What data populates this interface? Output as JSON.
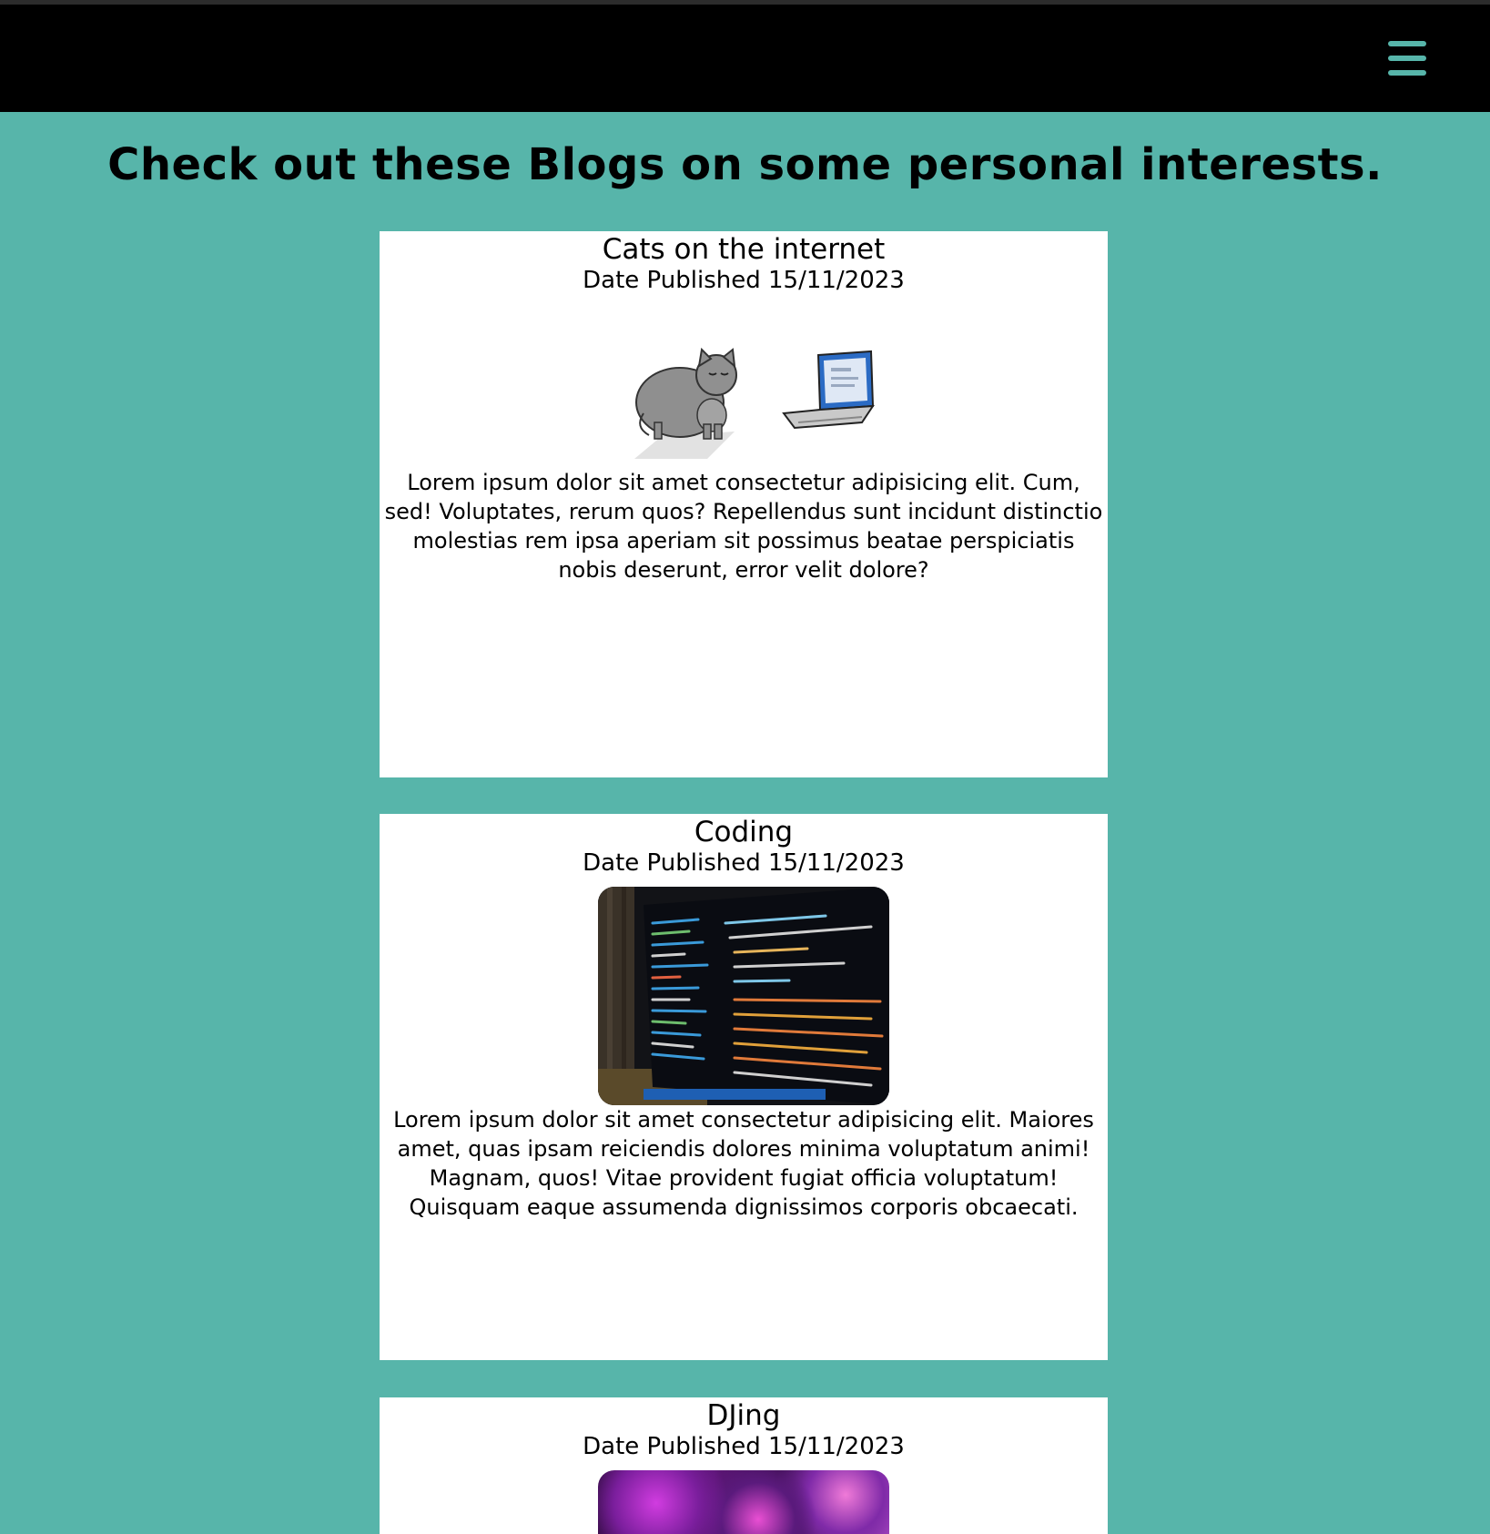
{
  "nav": {
    "menu_icon": "hamburger-menu-icon",
    "accent_color": "#57b5aa",
    "background_color": "#000000"
  },
  "page": {
    "title": "Check out these Blogs on some personal interests.",
    "background_color": "#57b5aa"
  },
  "blogs": [
    {
      "title": "Cats on the internet",
      "date": "Date Published 15/11/2023",
      "image": "cat-and-laptop-illustration",
      "text": "Lorem ipsum dolor sit amet consectetur adipisicing elit. Cum, sed! Voluptates, rerum quos? Repellendus sunt incidunt distinctio molestias rem ipsa aperiam sit possimus beatae perspiciatis nobis deserunt, error velit dolore?"
    },
    {
      "title": "Coding",
      "date": "Date Published 15/11/2023",
      "image": "code-on-monitor-photo",
      "text": "Lorem ipsum dolor sit amet consectetur adipisicing elit. Maiores amet, quas ipsam reiciendis dolores minima voluptatum animi! Magnam, quos! Vitae provident fugiat officia voluptatum! Quisquam eaque assumenda dignissimos corporis obcaecati."
    },
    {
      "title": "DJing",
      "date": "Date Published 15/11/2023",
      "image": "dj-equipment-photo"
    }
  ]
}
